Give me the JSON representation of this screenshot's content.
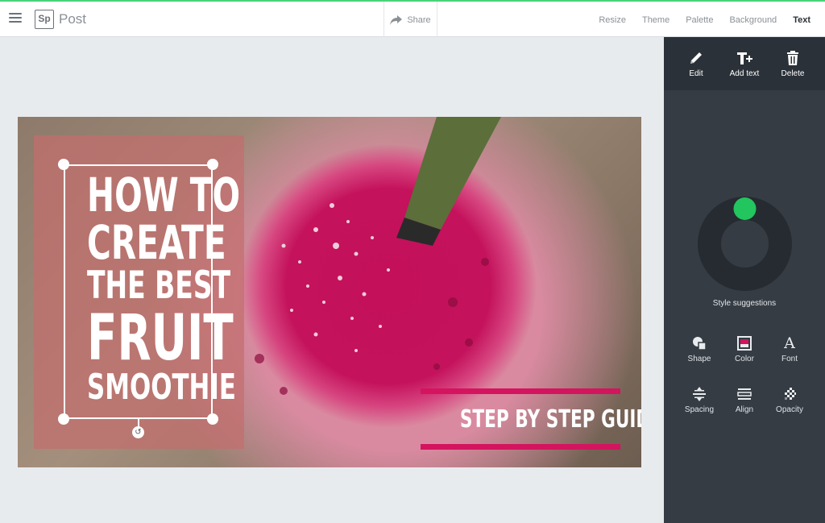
{
  "header": {
    "logo_text": "Sp",
    "app_title": "Post",
    "share_label": "Share",
    "nav": [
      {
        "label": "Resize"
      },
      {
        "label": "Theme"
      },
      {
        "label": "Palette"
      },
      {
        "label": "Background"
      },
      {
        "label": "Text",
        "active": true
      }
    ]
  },
  "design": {
    "headline_lines": [
      "HOW TO",
      "CREATE",
      "THE BEST",
      "FRUIT",
      "SMOOTHIE"
    ],
    "subtitle": "STEP BY STEP GUIDE",
    "colors": {
      "accent_bar": "#d4145e",
      "overlay": "#c46e6e",
      "text": "#ffffff"
    }
  },
  "panel": {
    "tools": [
      {
        "label": "Edit",
        "icon": "pencil-icon"
      },
      {
        "label": "Add text",
        "icon": "add-text-icon"
      },
      {
        "label": "Delete",
        "icon": "trash-icon"
      }
    ],
    "style_suggestions_label": "Style suggestions",
    "options": [
      {
        "label": "Shape",
        "icon": "shape-icon"
      },
      {
        "label": "Color",
        "icon": "color-icon"
      },
      {
        "label": "Font",
        "icon": "font-icon"
      },
      {
        "label": "Spacing",
        "icon": "spacing-icon"
      },
      {
        "label": "Align",
        "icon": "align-icon"
      },
      {
        "label": "Opacity",
        "icon": "opacity-icon"
      }
    ],
    "colors": {
      "background": "#353c44",
      "toolbar": "#2b3138",
      "dial_knob": "#22c55e"
    }
  },
  "top_accent_color": "#4ad27a"
}
